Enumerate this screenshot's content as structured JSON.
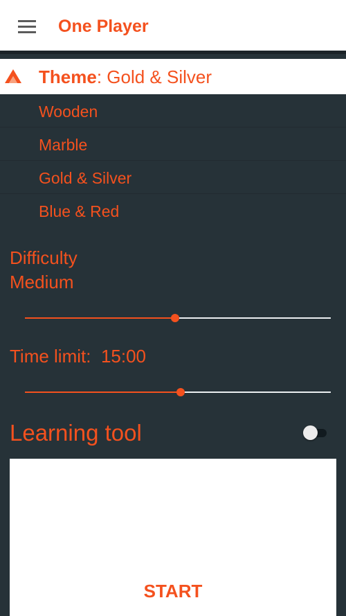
{
  "colors": {
    "accent": "#f4511e",
    "background": "#263238",
    "surface": "#ffffff",
    "menu_icon": "#5b5b5b"
  },
  "app_bar": {
    "title": "One Player",
    "menu_icon": "hamburger-menu-icon"
  },
  "theme": {
    "label": "Theme",
    "separator": ": ",
    "selected": "Gold & Silver",
    "collapse_icon": "chevron-up-icon",
    "options": [
      {
        "label": "Wooden"
      },
      {
        "label": "Marble"
      },
      {
        "label": "Gold & Silver"
      },
      {
        "label": "Blue & Red"
      }
    ]
  },
  "difficulty": {
    "label": "Difficulty",
    "value": "Medium",
    "slider_fraction": 0.49
  },
  "time_limit": {
    "label": "Time limit:",
    "value": "15:00",
    "slider_fraction": 0.51
  },
  "learning_tool": {
    "label": "Learning tool",
    "enabled": false
  },
  "start": {
    "label": "START"
  }
}
